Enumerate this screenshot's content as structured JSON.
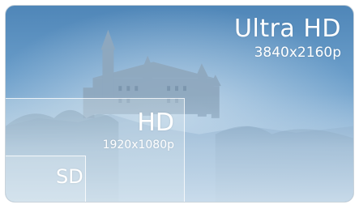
{
  "ultra_hd": {
    "label": "Ultra HD",
    "resolution": "3840x2160p"
  },
  "hd": {
    "label": "HD",
    "resolution": "1920x1080p"
  },
  "sd": {
    "label": "SD"
  },
  "colors": {
    "sky_top": "#4f86b8",
    "sky_bottom": "#a7c5df",
    "text": "#ffffff",
    "castle": "#9bb0c3"
  }
}
